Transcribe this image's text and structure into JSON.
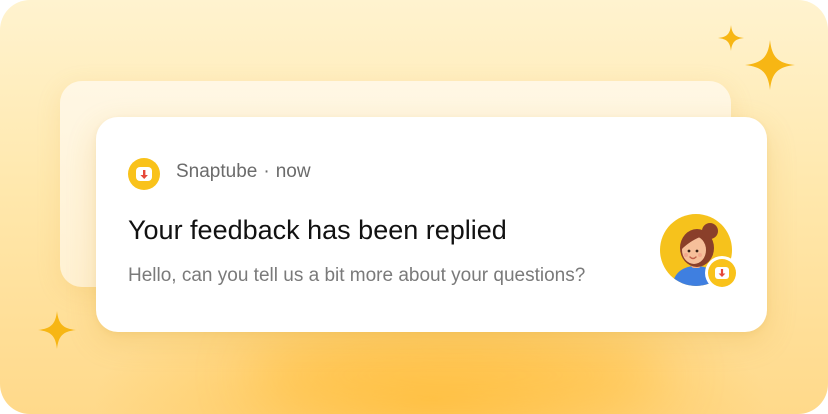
{
  "notification": {
    "app_name": "Snaptube",
    "separator": "·",
    "time": "now",
    "title": "Your feedback has been replied",
    "message": "Hello, can you tell us a bit more about your questions?"
  },
  "icons": {
    "app": "download-icon",
    "avatar": "support-agent-avatar",
    "badge": "download-icon",
    "decor": "sparkle-icon"
  },
  "colors": {
    "accent": "#f9c21a",
    "arrow": "#e5483a",
    "background": "#ffe8ad",
    "sparkle": "#f7b614"
  }
}
